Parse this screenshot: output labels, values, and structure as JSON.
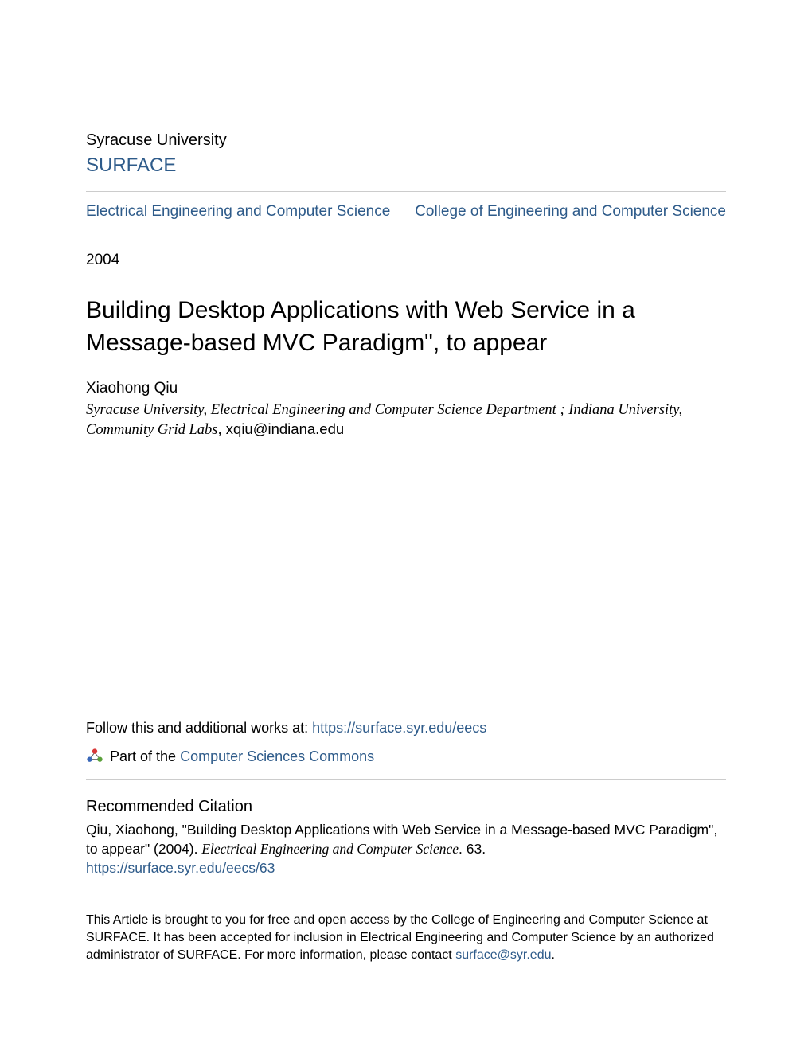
{
  "header": {
    "university": "Syracuse University",
    "surface": "SURFACE"
  },
  "nav": {
    "left": "Electrical Engineering and Computer Science",
    "right": "College of Engineering and Computer Science"
  },
  "year": "2004",
  "title": "Building Desktop Applications with Web Service in a Message-based MVC Paradigm\", to appear",
  "author": {
    "name": "Xiaohong Qiu",
    "affiliation": "Syracuse University, Electrical Engineering and Computer Science Department ; Indiana University, Community Grid Labs",
    "affiliation_suffix": ", xqiu@indiana.edu"
  },
  "follow": {
    "prefix": "Follow this and additional works at: ",
    "url": "https://surface.syr.edu/eecs"
  },
  "partof": {
    "prefix": "Part of the ",
    "link": "Computer Sciences Commons"
  },
  "citation": {
    "header": "Recommended Citation",
    "text_prefix": "Qiu, Xiaohong, \"Building Desktop Applications with Web Service in a Message-based MVC Paradigm\", to appear\" (2004). ",
    "text_italic": "Electrical Engineering and Computer Science",
    "text_suffix": ". 63.",
    "url": "https://surface.syr.edu/eecs/63"
  },
  "footer": {
    "text_prefix": "This Article is brought to you for free and open access by the College of Engineering and Computer Science at SURFACE. It has been accepted for inclusion in Electrical Engineering and Computer Science by an authorized administrator of SURFACE. For more information, please contact ",
    "email": "surface@syr.edu",
    "text_suffix": "."
  }
}
